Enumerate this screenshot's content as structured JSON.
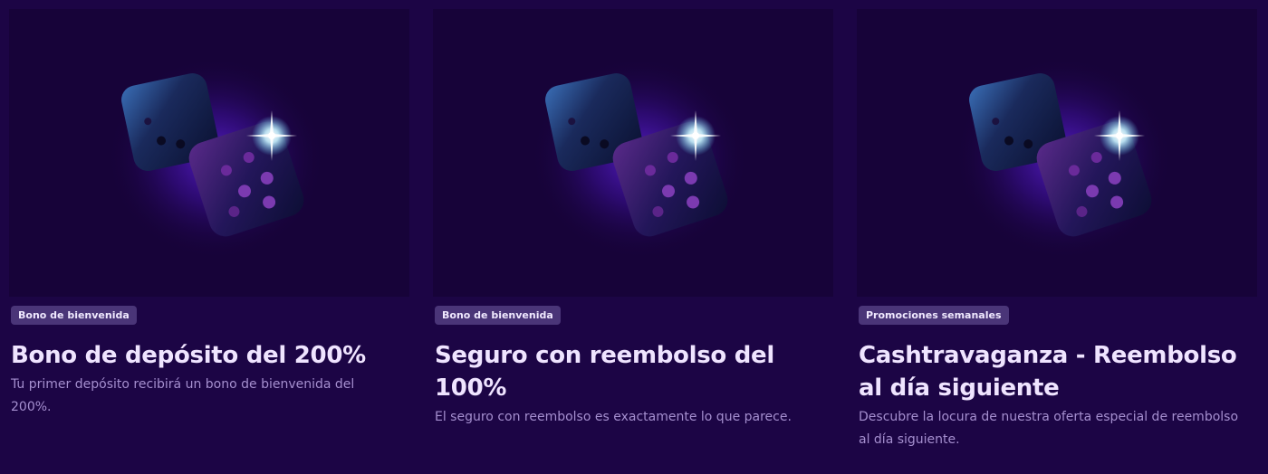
{
  "cards": [
    {
      "image_icon": "dice-icon",
      "tag": "Bono de bienvenida",
      "title": "Bono de depósito del 200%",
      "description": "Tu primer depósito recibirá un bono de bienvenida del 200%."
    },
    {
      "image_icon": "dice-icon",
      "tag": "Bono de bienvenida",
      "title": "Seguro con reembolso del 100%",
      "description": "El seguro con reembolso es exactamente lo que parece."
    },
    {
      "image_icon": "dice-icon",
      "tag": "Promociones semanales",
      "title": "Cashtravaganza - Reembolso al día siguiente",
      "description": "Descubre la locura de nuestra oferta especial de reembolso al día siguiente."
    }
  ],
  "colors": {
    "page_background": "#1c0545",
    "image_background": "#170339",
    "tag_background": "#4a3578",
    "title_text": "#efe4ff",
    "description_text": "#a58fcf"
  }
}
